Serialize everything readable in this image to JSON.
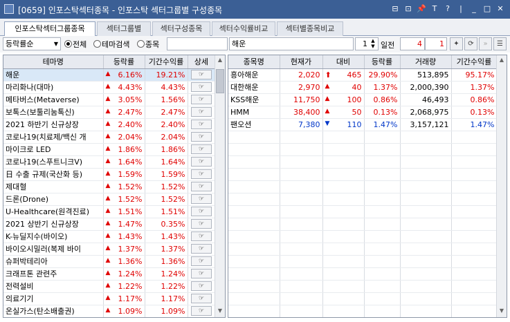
{
  "window": {
    "title": "[0659] 인포스탁섹터종목 - 인포스탁 섹터그룹별 구성종목",
    "controls": [
      "⊟",
      "⊡",
      "📌",
      "T",
      "?",
      "|",
      "_",
      "□",
      "✕"
    ]
  },
  "tabs": [
    "인포스탁섹터그룹종목",
    "섹터그룹별",
    "섹터구성종목",
    "섹터수익률비교",
    "섹터별종목비교"
  ],
  "toolbar": {
    "sort_select": "등락률순",
    "radio_all": "전체",
    "radio_theme": "테마검색",
    "radio_stock": "종목",
    "search_value": "해운",
    "count_value": "1",
    "period_label": "일전",
    "period_from": "4",
    "period_to": "1"
  },
  "left_table": {
    "headers": [
      "테마명",
      "등락률",
      "기간수익률",
      "상세"
    ],
    "rows": [
      {
        "name": "해운",
        "rate": "6.16%",
        "period": "19.21%"
      },
      {
        "name": "마리화나(대마)",
        "rate": "4.43%",
        "period": "4.43%"
      },
      {
        "name": "메타버스(Metaverse)",
        "rate": "3.05%",
        "period": "1.56%"
      },
      {
        "name": "보톡스(보툴리눔톡신)",
        "rate": "2.47%",
        "period": "2.47%"
      },
      {
        "name": "2021 하반기 신규상장",
        "rate": "2.40%",
        "period": "2.40%"
      },
      {
        "name": "코로나19(치료제/백신 개",
        "rate": "2.04%",
        "period": "2.04%"
      },
      {
        "name": "마이크로 LED",
        "rate": "1.86%",
        "period": "1.86%"
      },
      {
        "name": "코로나19(스푸트니크V)",
        "rate": "1.64%",
        "period": "1.64%"
      },
      {
        "name": "日 수출 규제(국산화 등)",
        "rate": "1.59%",
        "period": "1.59%"
      },
      {
        "name": "제대혈",
        "rate": "1.52%",
        "period": "1.52%"
      },
      {
        "name": "드론(Drone)",
        "rate": "1.52%",
        "period": "1.52%"
      },
      {
        "name": "U-Healthcare(원격진료)",
        "rate": "1.51%",
        "period": "1.51%"
      },
      {
        "name": "2021 상반기 신규상장",
        "rate": "1.47%",
        "period": "0.35%"
      },
      {
        "name": "K-뉴딜지수(바이오)",
        "rate": "1.43%",
        "period": "1.43%"
      },
      {
        "name": "바이오시밀러(복제 바이",
        "rate": "1.37%",
        "period": "1.37%"
      },
      {
        "name": "슈퍼박테리아",
        "rate": "1.36%",
        "period": "1.36%"
      },
      {
        "name": "크래프톤 관련주",
        "rate": "1.24%",
        "period": "1.24%"
      },
      {
        "name": "전력설비",
        "rate": "1.22%",
        "period": "1.22%"
      },
      {
        "name": "의료기기",
        "rate": "1.17%",
        "period": "1.17%"
      },
      {
        "name": "온실가스(탄소배출권)",
        "rate": "1.09%",
        "period": "1.09%"
      }
    ],
    "detail_label": "☞"
  },
  "right_table": {
    "headers": [
      "종목명",
      "현재가",
      "대비",
      "등락률",
      "거래량",
      "기간수익률"
    ],
    "rows": [
      {
        "name": "흥아해운",
        "price": "2,020",
        "dir": "limit-up",
        "diff": "465",
        "rate": "29.90%",
        "volume": "513,895",
        "period": "95.17%"
      },
      {
        "name": "대한해운",
        "price": "2,970",
        "dir": "up",
        "diff": "40",
        "rate": "1.37%",
        "volume": "2,000,390",
        "period": "1.37%"
      },
      {
        "name": "KSS해운",
        "price": "11,750",
        "dir": "up",
        "diff": "100",
        "rate": "0.86%",
        "volume": "46,493",
        "period": "0.86%"
      },
      {
        "name": "HMM",
        "price": "38,400",
        "dir": "up",
        "diff": "50",
        "rate": "0.13%",
        "volume": "2,068,975",
        "period": "0.13%"
      },
      {
        "name": "팬오션",
        "price": "7,380",
        "dir": "down",
        "diff": "110",
        "rate": "1.47%",
        "volume": "3,157,121",
        "period": "1.47%"
      }
    ]
  },
  "colors": {
    "up": "#e00000",
    "down": "#0036c8",
    "titlebar": "#3b5f95",
    "selected_row": "#d9e8f7"
  }
}
